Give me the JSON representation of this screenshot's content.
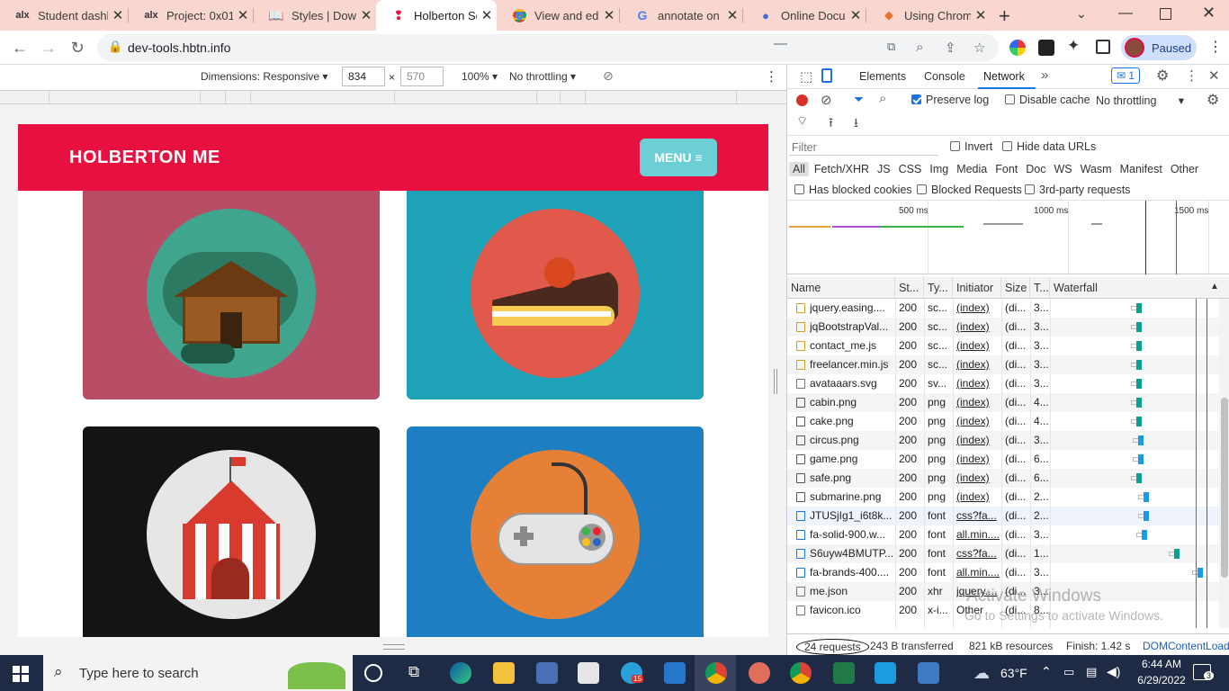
{
  "browser": {
    "tabs": [
      {
        "title": "Student dashboard",
        "icon": "alx-icon"
      },
      {
        "title": "Project: 0x01. Flexbox",
        "icon": "alx-icon"
      },
      {
        "title": "Styles | Down",
        "icon": "book-icon"
      },
      {
        "title": "Holberton Sc",
        "icon": "holberton-icon"
      },
      {
        "title": "View and edit",
        "icon": "chrome-icon"
      },
      {
        "title": "annotate on p",
        "icon": "google-icon"
      },
      {
        "title": "Online Docum",
        "icon": "people-icon"
      },
      {
        "title": "Using Chrom",
        "icon": "devtools-icon"
      }
    ],
    "url": "dev-tools.hbtn.info",
    "profile_status": "Paused"
  },
  "device_toolbar": {
    "dimensions_label": "Dimensions: Responsive",
    "width": "834",
    "height": "570",
    "zoom": "100%",
    "throttling": "No throttling"
  },
  "page": {
    "brand": "HOLBERTON ME",
    "menu_label": "MENU",
    "cards": [
      {
        "name": "cabin",
        "bg": "#b84e66",
        "circle": "#3fa58c"
      },
      {
        "name": "cake",
        "bg": "#1ea2b8",
        "circle": "#e0594a"
      },
      {
        "name": "circus",
        "bg": "#141414",
        "circle": "#e6e6e6"
      },
      {
        "name": "game",
        "bg": "#1d7fc2",
        "circle": "#e58036"
      }
    ]
  },
  "devtools": {
    "tabs": [
      "Elements",
      "Console",
      "Network"
    ],
    "active_tab": "Network",
    "issues_count": "1",
    "preserve_log": "Preserve log",
    "disable_cache": "Disable cache",
    "throttling": "No throttling",
    "filter_placeholder": "Filter",
    "invert": "Invert",
    "hide_data_urls": "Hide data URLs",
    "type_filters": [
      "All",
      "Fetch/XHR",
      "JS",
      "CSS",
      "Img",
      "Media",
      "Font",
      "Doc",
      "WS",
      "Wasm",
      "Manifest",
      "Other"
    ],
    "blocked_cookies": "Has blocked cookies",
    "blocked_requests": "Blocked Requests",
    "third_party": "3rd-party requests",
    "timeline_ticks": [
      "500 ms",
      "1000 ms",
      "1500 ms"
    ],
    "columns": [
      "Name",
      "St...",
      "Ty...",
      "Initiator",
      "Size",
      "T...",
      "Waterfall"
    ],
    "rows": [
      {
        "name": "jquery.easing....",
        "status": "200",
        "type": "sc...",
        "initiator": "(index)",
        "size": "(di...",
        "time": "3..."
      },
      {
        "name": "jqBootstrapVal...",
        "status": "200",
        "type": "sc...",
        "initiator": "(index)",
        "size": "(di...",
        "time": "3..."
      },
      {
        "name": "contact_me.js",
        "status": "200",
        "type": "sc...",
        "initiator": "(index)",
        "size": "(di...",
        "time": "3..."
      },
      {
        "name": "freelancer.min.js",
        "status": "200",
        "type": "sc...",
        "initiator": "(index)",
        "size": "(di...",
        "time": "3..."
      },
      {
        "name": "avataaars.svg",
        "status": "200",
        "type": "sv...",
        "initiator": "(index)",
        "size": "(di...",
        "time": "3..."
      },
      {
        "name": "cabin.png",
        "status": "200",
        "type": "png",
        "initiator": "(index)",
        "size": "(di...",
        "time": "4..."
      },
      {
        "name": "cake.png",
        "status": "200",
        "type": "png",
        "initiator": "(index)",
        "size": "(di...",
        "time": "4..."
      },
      {
        "name": "circus.png",
        "status": "200",
        "type": "png",
        "initiator": "(index)",
        "size": "(di...",
        "time": "3..."
      },
      {
        "name": "game.png",
        "status": "200",
        "type": "png",
        "initiator": "(index)",
        "size": "(di...",
        "time": "6..."
      },
      {
        "name": "safe.png",
        "status": "200",
        "type": "png",
        "initiator": "(index)",
        "size": "(di...",
        "time": "6..."
      },
      {
        "name": "submarine.png",
        "status": "200",
        "type": "png",
        "initiator": "(index)",
        "size": "(di...",
        "time": "2..."
      },
      {
        "name": "JTUSjIg1_i6t8k...",
        "status": "200",
        "type": "font",
        "initiator": "css?fa...",
        "size": "(di...",
        "time": "2..."
      },
      {
        "name": "fa-solid-900.w...",
        "status": "200",
        "type": "font",
        "initiator": "all.min....",
        "size": "(di...",
        "time": "3..."
      },
      {
        "name": "S6uyw4BMUTP...",
        "status": "200",
        "type": "font",
        "initiator": "css?fa...",
        "size": "(di...",
        "time": "1..."
      },
      {
        "name": "fa-brands-400....",
        "status": "200",
        "type": "font",
        "initiator": "all.min....",
        "size": "(di...",
        "time": "3..."
      },
      {
        "name": "me.json",
        "status": "200",
        "type": "xhr",
        "initiator": "jquery....",
        "size": "(di...",
        "time": "3..."
      },
      {
        "name": "favicon.ico",
        "status": "200",
        "type": "x-i...",
        "initiator": "Other",
        "size": "(di...",
        "time": "8..."
      }
    ],
    "status_bar": {
      "requests": "24 requests",
      "transferred": "243 B transferred",
      "resources": "821 kB resources",
      "finish": "Finish: 1.42 s",
      "domcontent": "DOMContentLoad"
    }
  },
  "watermark": {
    "line1": "Activate Windows",
    "line2": "Go to Settings to activate Windows."
  },
  "taskbar": {
    "search_placeholder": "Type here to search",
    "temperature": "63°F",
    "time": "6:44 AM",
    "date": "6/29/2022",
    "notification_count": "3",
    "telegram_badge": "15"
  }
}
